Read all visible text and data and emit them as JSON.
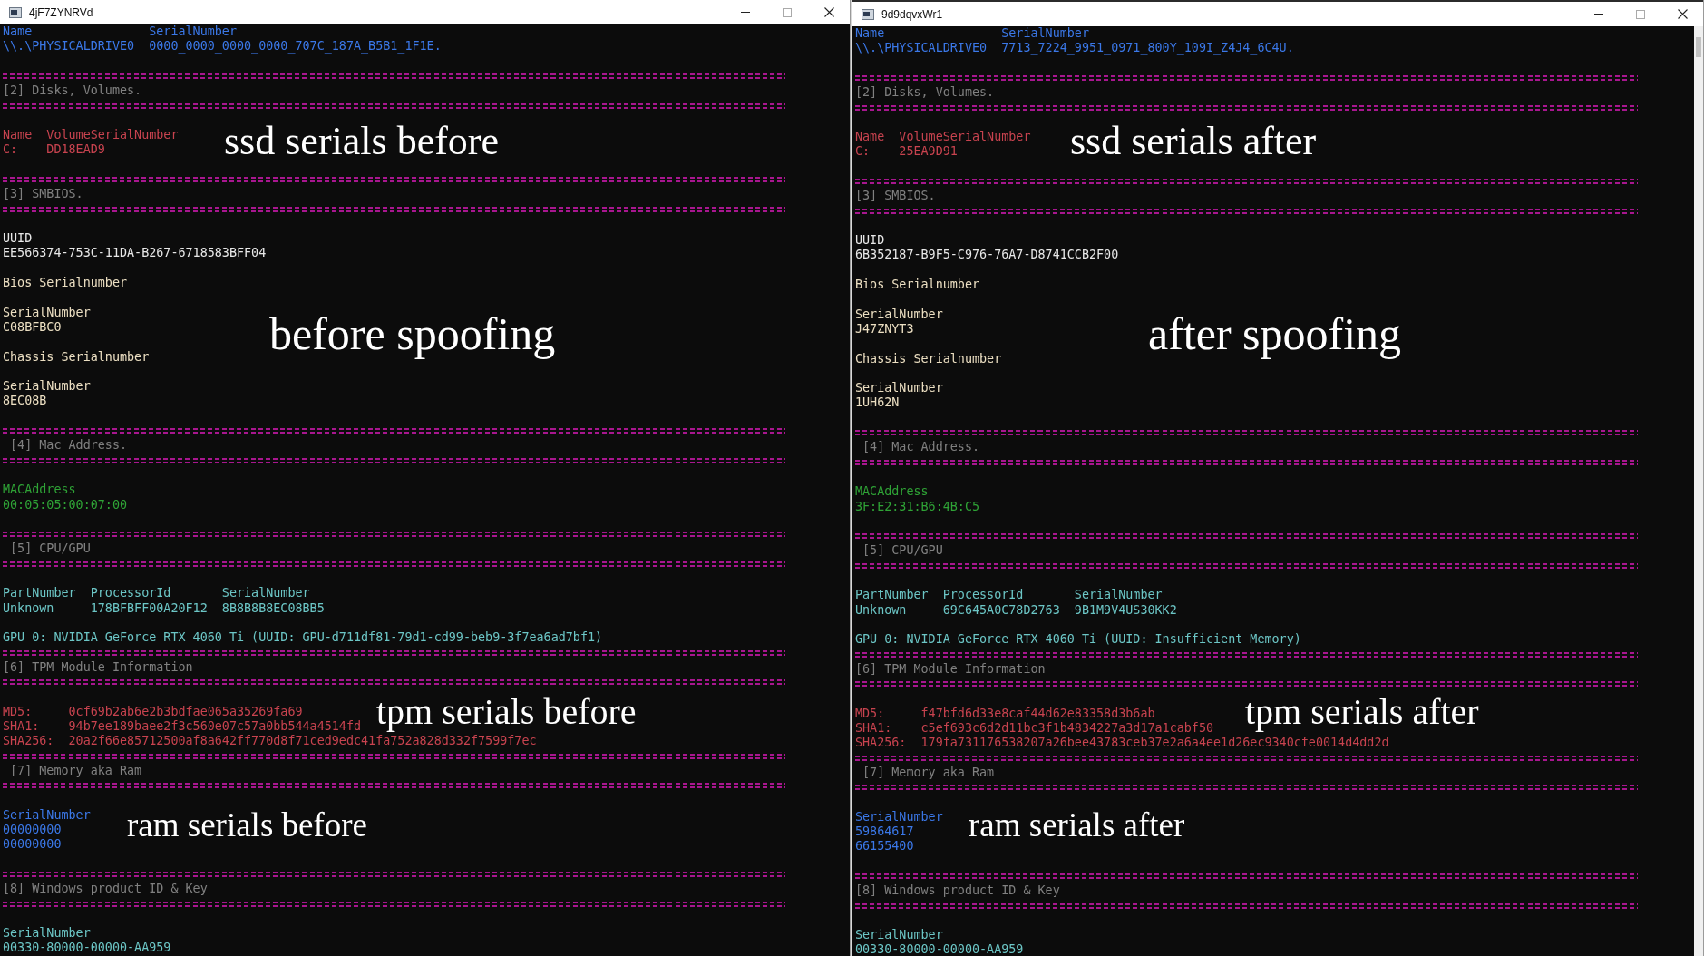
{
  "windows": [
    {
      "title": "4jF7ZYNRVd",
      "active": false,
      "scrollbar": false,
      "lines": [
        {
          "kind": "table",
          "color": "#3b78e8",
          "header": [
            "Name",
            "SerialNumber"
          ],
          "rows": [
            [
              "\\\\.\\PHYSICALDRIVE0",
              "0000_0000_0000_0000_707C_187A_B5B1_1F1E."
            ]
          ]
        },
        {
          "kind": "blank"
        },
        {
          "kind": "divider"
        },
        {
          "kind": "heading",
          "text": "[2] Disks, Volumes.",
          "indent": false
        },
        {
          "kind": "divider"
        },
        {
          "kind": "blank"
        },
        {
          "kind": "table",
          "color": "#c8434f",
          "header": [
            "Name",
            "VolumeSerialNumber"
          ],
          "rows": [
            [
              "C:",
              "DD18EAD9"
            ]
          ]
        },
        {
          "kind": "blank"
        },
        {
          "kind": "divider"
        },
        {
          "kind": "heading",
          "text": "[3] SMBIOS.",
          "indent": false
        },
        {
          "kind": "divider"
        },
        {
          "kind": "blank"
        },
        {
          "kind": "text",
          "color": "#e8e8e8",
          "text": "UUID"
        },
        {
          "kind": "text",
          "color": "#e8e8e8",
          "text": "EE566374-753C-11DA-B267-6718583BFF04"
        },
        {
          "kind": "blank"
        },
        {
          "kind": "text",
          "color": "#ecdfc2",
          "text": "Bios Serialnumber"
        },
        {
          "kind": "blank"
        },
        {
          "kind": "text",
          "color": "#ecdfc2",
          "text": "SerialNumber"
        },
        {
          "kind": "text",
          "color": "#ecdfc2",
          "text": "C08BFBC0"
        },
        {
          "kind": "blank"
        },
        {
          "kind": "text",
          "color": "#ecdfc2",
          "text": "Chassis Serialnumber"
        },
        {
          "kind": "blank"
        },
        {
          "kind": "text",
          "color": "#ecdfc2",
          "text": "SerialNumber"
        },
        {
          "kind": "text",
          "color": "#ecdfc2",
          "text": "8EC08B"
        },
        {
          "kind": "blank"
        },
        {
          "kind": "divider"
        },
        {
          "kind": "heading",
          "text": "[4] Mac Address.",
          "indent": true
        },
        {
          "kind": "divider"
        },
        {
          "kind": "blank"
        },
        {
          "kind": "text",
          "color": "#2fa336",
          "text": "MACAddress"
        },
        {
          "kind": "text",
          "color": "#2fa336",
          "text": "00:05:05:00:07:00"
        },
        {
          "kind": "blank"
        },
        {
          "kind": "divider"
        },
        {
          "kind": "heading",
          "text": "[5] CPU/GPU",
          "indent": true
        },
        {
          "kind": "divider"
        },
        {
          "kind": "blank"
        },
        {
          "kind": "table",
          "color": "#6cc6c6",
          "header": [
            "PartNumber",
            "ProcessorId",
            "SerialNumber"
          ],
          "rows": [
            [
              "Unknown",
              "178BFBFF00A20F12",
              "8B8B8B8EC08BB5"
            ]
          ]
        },
        {
          "kind": "blank"
        },
        {
          "kind": "text",
          "color": "#6cc6c6",
          "text": "GPU 0: NVIDIA GeForce RTX 4060 Ti (UUID: GPU-d711df81-79d1-cd99-beb9-3f7ea6ad7bf1)"
        },
        {
          "kind": "divider"
        },
        {
          "kind": "heading",
          "text": "[6] TPM Module Information",
          "indent": false
        },
        {
          "kind": "divider"
        },
        {
          "kind": "blank"
        },
        {
          "kind": "table",
          "color": "#c8434f",
          "rows": [
            [
              "MD5:",
              "0cf69b2ab6e2b3bdfae065a35269fa69"
            ],
            [
              "SHA1:",
              "94b7ee189baee2f3c560e07c57a0bb544a4514fd"
            ],
            [
              "SHA256:",
              "20a2f66e85712500af8a642ff770d8f71ced9edc41fa752a828d332f7599f7ec"
            ]
          ]
        },
        {
          "kind": "divider"
        },
        {
          "kind": "heading",
          "text": "[7] Memory aka Ram",
          "indent": true
        },
        {
          "kind": "divider"
        },
        {
          "kind": "blank"
        },
        {
          "kind": "table",
          "color": "#3b78e8",
          "header": [
            "SerialNumber"
          ],
          "rows": [
            [
              "00000000"
            ],
            [
              "00000000"
            ]
          ]
        },
        {
          "kind": "blank"
        },
        {
          "kind": "divider"
        },
        {
          "kind": "heading",
          "text": "[8] Windows product ID & Key",
          "indent": false
        },
        {
          "kind": "divider"
        },
        {
          "kind": "blank"
        },
        {
          "kind": "text",
          "color": "#6cc6c6",
          "text": "SerialNumber"
        },
        {
          "kind": "text",
          "color": "#6cc6c6",
          "text": "00330-80000-00000-AA959"
        }
      ],
      "annotations": [
        "ssd serials before",
        "before spoofing",
        "tpm serials before",
        "ram serials before"
      ]
    },
    {
      "title": "9d9dqvxWr1",
      "active": true,
      "scrollbar": true,
      "lines": [
        {
          "kind": "table",
          "color": "#3b78e8",
          "header": [
            "Name",
            "SerialNumber"
          ],
          "rows": [
            [
              "\\\\.\\PHYSICALDRIVE0",
              "7713_7224_9951_0971_800Y_109I_Z4J4_6C4U."
            ]
          ]
        },
        {
          "kind": "blank"
        },
        {
          "kind": "divider"
        },
        {
          "kind": "heading",
          "text": "[2] Disks, Volumes.",
          "indent": false
        },
        {
          "kind": "divider"
        },
        {
          "kind": "blank"
        },
        {
          "kind": "table",
          "color": "#c8434f",
          "header": [
            "Name",
            "VolumeSerialNumber"
          ],
          "rows": [
            [
              "C:",
              "25EA9D91"
            ]
          ]
        },
        {
          "kind": "blank"
        },
        {
          "kind": "divider"
        },
        {
          "kind": "heading",
          "text": "[3] SMBIOS.",
          "indent": false
        },
        {
          "kind": "divider"
        },
        {
          "kind": "blank"
        },
        {
          "kind": "text",
          "color": "#e8e8e8",
          "text": "UUID"
        },
        {
          "kind": "text",
          "color": "#e8e8e8",
          "text": "6B352187-B9F5-C976-76A7-D8741CCB2F00"
        },
        {
          "kind": "blank"
        },
        {
          "kind": "text",
          "color": "#ecdfc2",
          "text": "Bios Serialnumber"
        },
        {
          "kind": "blank"
        },
        {
          "kind": "text",
          "color": "#ecdfc2",
          "text": "SerialNumber"
        },
        {
          "kind": "text",
          "color": "#ecdfc2",
          "text": "J47ZNYT3"
        },
        {
          "kind": "blank"
        },
        {
          "kind": "text",
          "color": "#ecdfc2",
          "text": "Chassis Serialnumber"
        },
        {
          "kind": "blank"
        },
        {
          "kind": "text",
          "color": "#ecdfc2",
          "text": "SerialNumber"
        },
        {
          "kind": "text",
          "color": "#ecdfc2",
          "text": "1UH62N"
        },
        {
          "kind": "blank"
        },
        {
          "kind": "divider"
        },
        {
          "kind": "heading",
          "text": "[4] Mac Address.",
          "indent": true
        },
        {
          "kind": "divider"
        },
        {
          "kind": "blank"
        },
        {
          "kind": "text",
          "color": "#2fa336",
          "text": "MACAddress"
        },
        {
          "kind": "text",
          "color": "#2fa336",
          "text": "3F:E2:31:B6:4B:C5"
        },
        {
          "kind": "blank"
        },
        {
          "kind": "divider"
        },
        {
          "kind": "heading",
          "text": "[5] CPU/GPU",
          "indent": true
        },
        {
          "kind": "divider"
        },
        {
          "kind": "blank"
        },
        {
          "kind": "table",
          "color": "#6cc6c6",
          "header": [
            "PartNumber",
            "ProcessorId",
            "SerialNumber"
          ],
          "rows": [
            [
              "Unknown",
              "69C645A0C78D2763",
              "9B1M9V4US30KK2"
            ]
          ]
        },
        {
          "kind": "blank"
        },
        {
          "kind": "text",
          "color": "#6cc6c6",
          "text": "GPU 0: NVIDIA GeForce RTX 4060 Ti (UUID: Insufficient Memory)"
        },
        {
          "kind": "divider"
        },
        {
          "kind": "heading",
          "text": "[6] TPM Module Information",
          "indent": false
        },
        {
          "kind": "divider"
        },
        {
          "kind": "blank"
        },
        {
          "kind": "table",
          "color": "#c8434f",
          "rows": [
            [
              "MD5:",
              "f47bfd6d33e8caf44d62e83358d3b6ab"
            ],
            [
              "SHA1:",
              "c5ef693c6d2d11bc3f1b4834227a3d17a1cabf50"
            ],
            [
              "SHA256:",
              "179fa731176538207a26bee43783ceb37e2a6a4ee1d26ec9340cfe0014d4dd2d"
            ]
          ]
        },
        {
          "kind": "divider"
        },
        {
          "kind": "heading",
          "text": "[7] Memory aka Ram",
          "indent": true
        },
        {
          "kind": "divider"
        },
        {
          "kind": "blank"
        },
        {
          "kind": "table",
          "color": "#3b78e8",
          "header": [
            "SerialNumber"
          ],
          "rows": [
            [
              "59864617"
            ],
            [
              "66155400"
            ]
          ]
        },
        {
          "kind": "blank"
        },
        {
          "kind": "divider"
        },
        {
          "kind": "heading",
          "text": "[8] Windows product ID & Key",
          "indent": false
        },
        {
          "kind": "divider"
        },
        {
          "kind": "blank"
        },
        {
          "kind": "text",
          "color": "#6cc6c6",
          "text": "SerialNumber"
        },
        {
          "kind": "text",
          "color": "#6cc6c6",
          "text": "00330-80000-00000-AA959"
        }
      ],
      "annotations": [
        "ssd serials after",
        "after spoofing",
        "tpm serials after",
        "ram serials after"
      ]
    }
  ]
}
